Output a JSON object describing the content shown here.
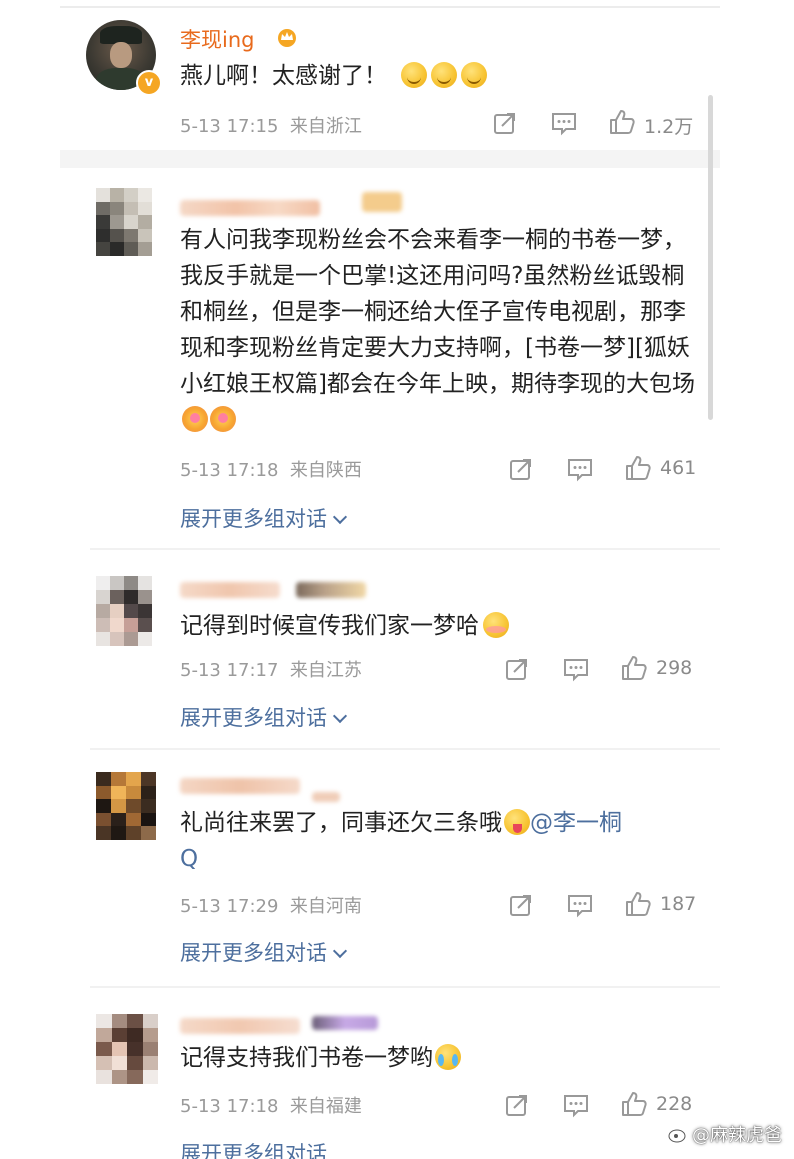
{
  "top_post": {
    "username": "李现ing",
    "text": "燕儿啊！太感谢了！",
    "time": "5-13 17:15",
    "location": "来自浙江",
    "likes": "1.2万",
    "icons": [
      "crown-icon",
      "verified-badge-icon",
      "repost-icon",
      "comment-icon",
      "like-icon"
    ]
  },
  "comments": [
    {
      "text": "有人问我李现粉丝会不会来看李一桐的书卷一梦，我反手就是一个巴掌!这还用问吗?虽然粉丝诋毁桐和桐丝，但是李一桐还给大侄子宣传电视剧，那李现和李现粉丝肯定要大力支持啊，[书卷一梦][狐妖小红娘王权篇]都会在今年上映，期待李现的大包场",
      "time": "5-13 17:18",
      "location": "来自陕西",
      "likes": "461",
      "expand": "展开更多组对话"
    },
    {
      "text": "记得到时候宣传我们家一梦哈",
      "time": "5-13 17:17",
      "location": "来自江苏",
      "likes": "298",
      "expand": "展开更多组对话"
    },
    {
      "text": "礼尚往来罢了，同事还欠三条哦",
      "mention": "@李一桐",
      "mention_tail": "Q",
      "time": "5-13 17:29",
      "location": "来自河南",
      "likes": "187",
      "expand": "展开更多组对话"
    },
    {
      "text": "记得支持我们书卷一梦哟",
      "time": "5-13 17:18",
      "location": "来自福建",
      "likes": "228",
      "expand": "展开更多组对话"
    }
  ],
  "watermark": "@麻辣虎爸",
  "colors": {
    "username": "#e86a1c",
    "link": "#4d6f9e",
    "meta": "#9a9a9a",
    "badge": "#f5a623"
  }
}
